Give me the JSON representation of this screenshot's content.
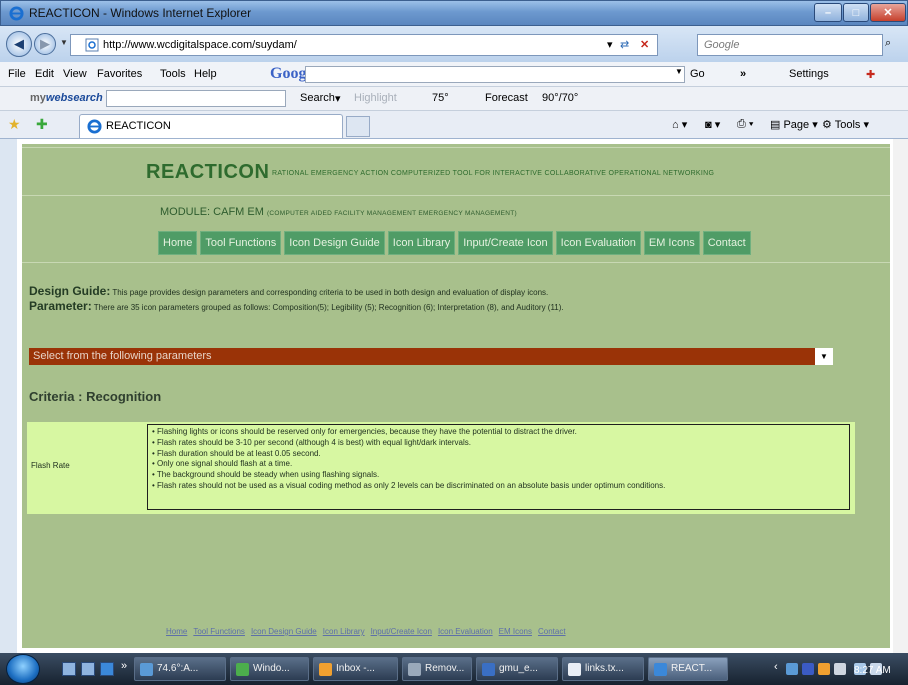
{
  "window": {
    "title": "REACTICON - Windows Internet Explorer"
  },
  "address": {
    "url": "http://www.wcdigitalspace.com/suydam/",
    "search_placeholder": "Google"
  },
  "menu": {
    "items": [
      "File",
      "Edit",
      "View",
      "Favorites",
      "Tools",
      "Help"
    ],
    "google_logo": "Google",
    "go": "Go",
    "settings": "Settings"
  },
  "toolbar2": {
    "logo_prefix": "my",
    "logo_brand": "websearch",
    "search": "Search",
    "highlight": "Highlight",
    "temp": "75°",
    "forecast": "Forecast",
    "forecast_value": "90°/70°"
  },
  "favbar": {
    "tab_title": "REACTICON",
    "page": "Page",
    "tools": "Tools"
  },
  "site": {
    "brand": "REACTICON",
    "brand_sub": "RATIONAL EMERGENCY ACTION COMPUTERIZED TOOL FOR INTERACTIVE COLLABORATIVE OPERATIONAL NETWORKING",
    "module_label": "MODULE: CAFM EM",
    "module_sub": "(COMPUTER AIDED FACILITY MANAGEMENT EMERGENCY MANAGEMENT)",
    "nav": [
      "Home",
      "Tool Functions",
      "Icon Design Guide",
      "Icon Library",
      "Input/Create Icon",
      "Icon Evaluation",
      "EM Icons",
      "Contact"
    ],
    "design_guide_label": "Design Guide:",
    "design_guide_text": "This page provides design parameters and corresponding criteria to be used in both design and evaluation of display icons.",
    "parameter_label": "Parameter:",
    "parameter_text": "There are 35 icon parameters grouped as follows: Composition(5); Legibility (5); Recognition (6); Interpretation (8), and Auditory (11).",
    "select_value": "Select from the following parameters",
    "criteria_heading": "Criteria : Recognition",
    "criteria_row": {
      "label": "Flash Rate",
      "items": [
        "• Flashing lights or icons should be reserved only for emergencies, because they have the potential to distract the driver.",
        "• Flash rates should be 3-10 per second (although 4 is best) with equal light/dark intervals.",
        "• Flash duration should be at least 0.05 second.",
        "• Only one signal should flash at a time.",
        "• The background should be steady when using flashing signals.",
        "• Flash rates should not be used as a visual coding method as only 2 levels can be discriminated on an absolute basis under optimum conditions."
      ]
    },
    "footer_links": [
      "Home",
      "Tool Functions",
      "Icon Design Guide",
      "Icon Library",
      "Input/Create Icon",
      "Icon Evaluation",
      "EM Icons",
      "Contact"
    ]
  },
  "taskbar": {
    "tasks": [
      "74.6°:A...",
      "Windo...",
      "Inbox -...",
      "Remov...",
      "gmu_e...",
      "links.tx...",
      "REACT..."
    ],
    "clock": "8:27 AM"
  }
}
